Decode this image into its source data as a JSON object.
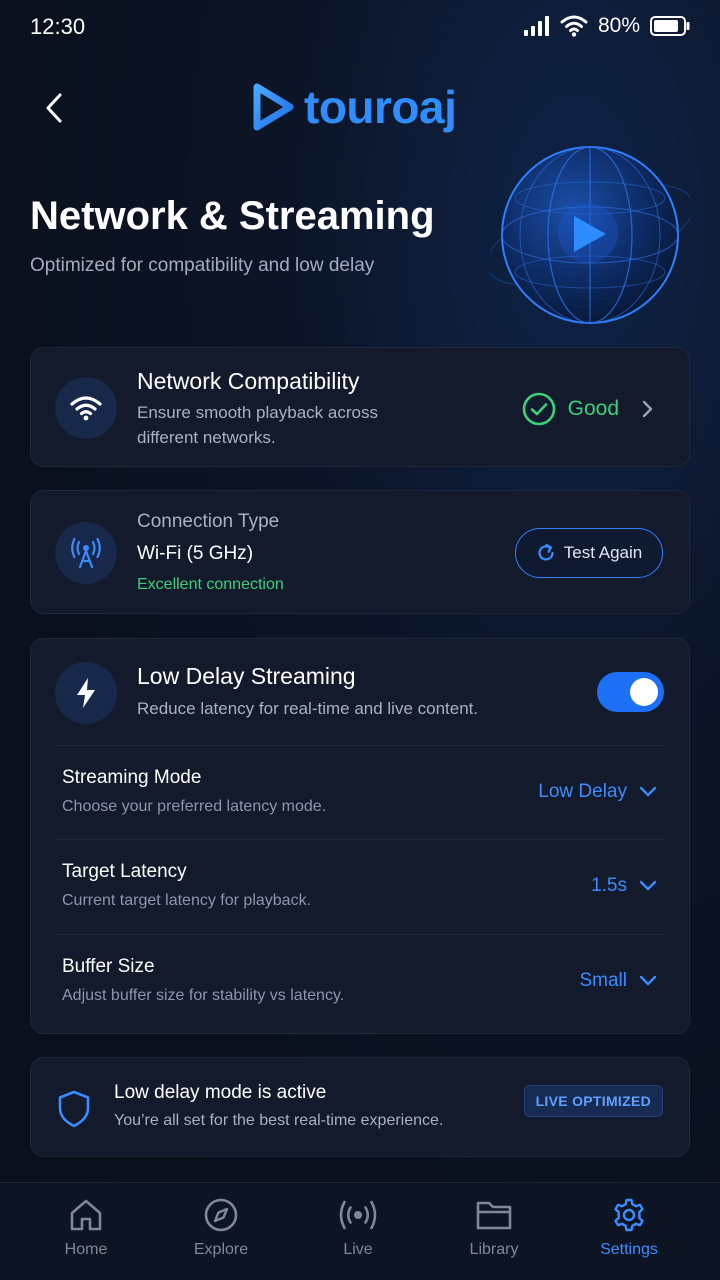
{
  "status_bar": {
    "time": "12:30",
    "battery": "80%"
  },
  "header": {
    "logo_text": "touroaj"
  },
  "page": {
    "title": "Network & Streaming",
    "subtitle": "Optimized for compatibility and low delay"
  },
  "network_compat": {
    "title": "Network Compatibility",
    "desc_line1": "Ensure smooth playback across",
    "desc_line2": "different networks.",
    "status": "Good"
  },
  "connection": {
    "label": "Connection Type",
    "value": "Wi-Fi (5 GHz)",
    "quality": "Excellent connection",
    "test_button": "Test Again"
  },
  "low_delay": {
    "title": "Low Delay Streaming",
    "desc": "Reduce latency for real-time and live content.",
    "enabled": true,
    "rows": [
      {
        "title": "Streaming Mode",
        "desc": "Choose your preferred latency mode.",
        "value": "Low Delay"
      },
      {
        "title": "Target Latency",
        "desc": "Current target latency for playback.",
        "value": "1.5s"
      },
      {
        "title": "Buffer Size",
        "desc": "Adjust buffer size for stability vs latency.",
        "value": "Small"
      }
    ]
  },
  "status_card": {
    "title": "Low delay mode is active",
    "desc": "You’re all set for the best real-time experience.",
    "badge": "LIVE OPTIMIZED"
  },
  "nav": [
    {
      "label": "Home",
      "icon": "home-icon",
      "active": false
    },
    {
      "label": "Explore",
      "icon": "compass-icon",
      "active": false
    },
    {
      "label": "Live",
      "icon": "broadcast-icon",
      "active": false
    },
    {
      "label": "Library",
      "icon": "folder-icon",
      "active": false
    },
    {
      "label": "Settings",
      "icon": "gear-icon",
      "active": true
    }
  ],
  "colors": {
    "accent": "#2f8dff",
    "success": "#3dd07a",
    "background": "#0b1120",
    "card": "#121a2b"
  }
}
